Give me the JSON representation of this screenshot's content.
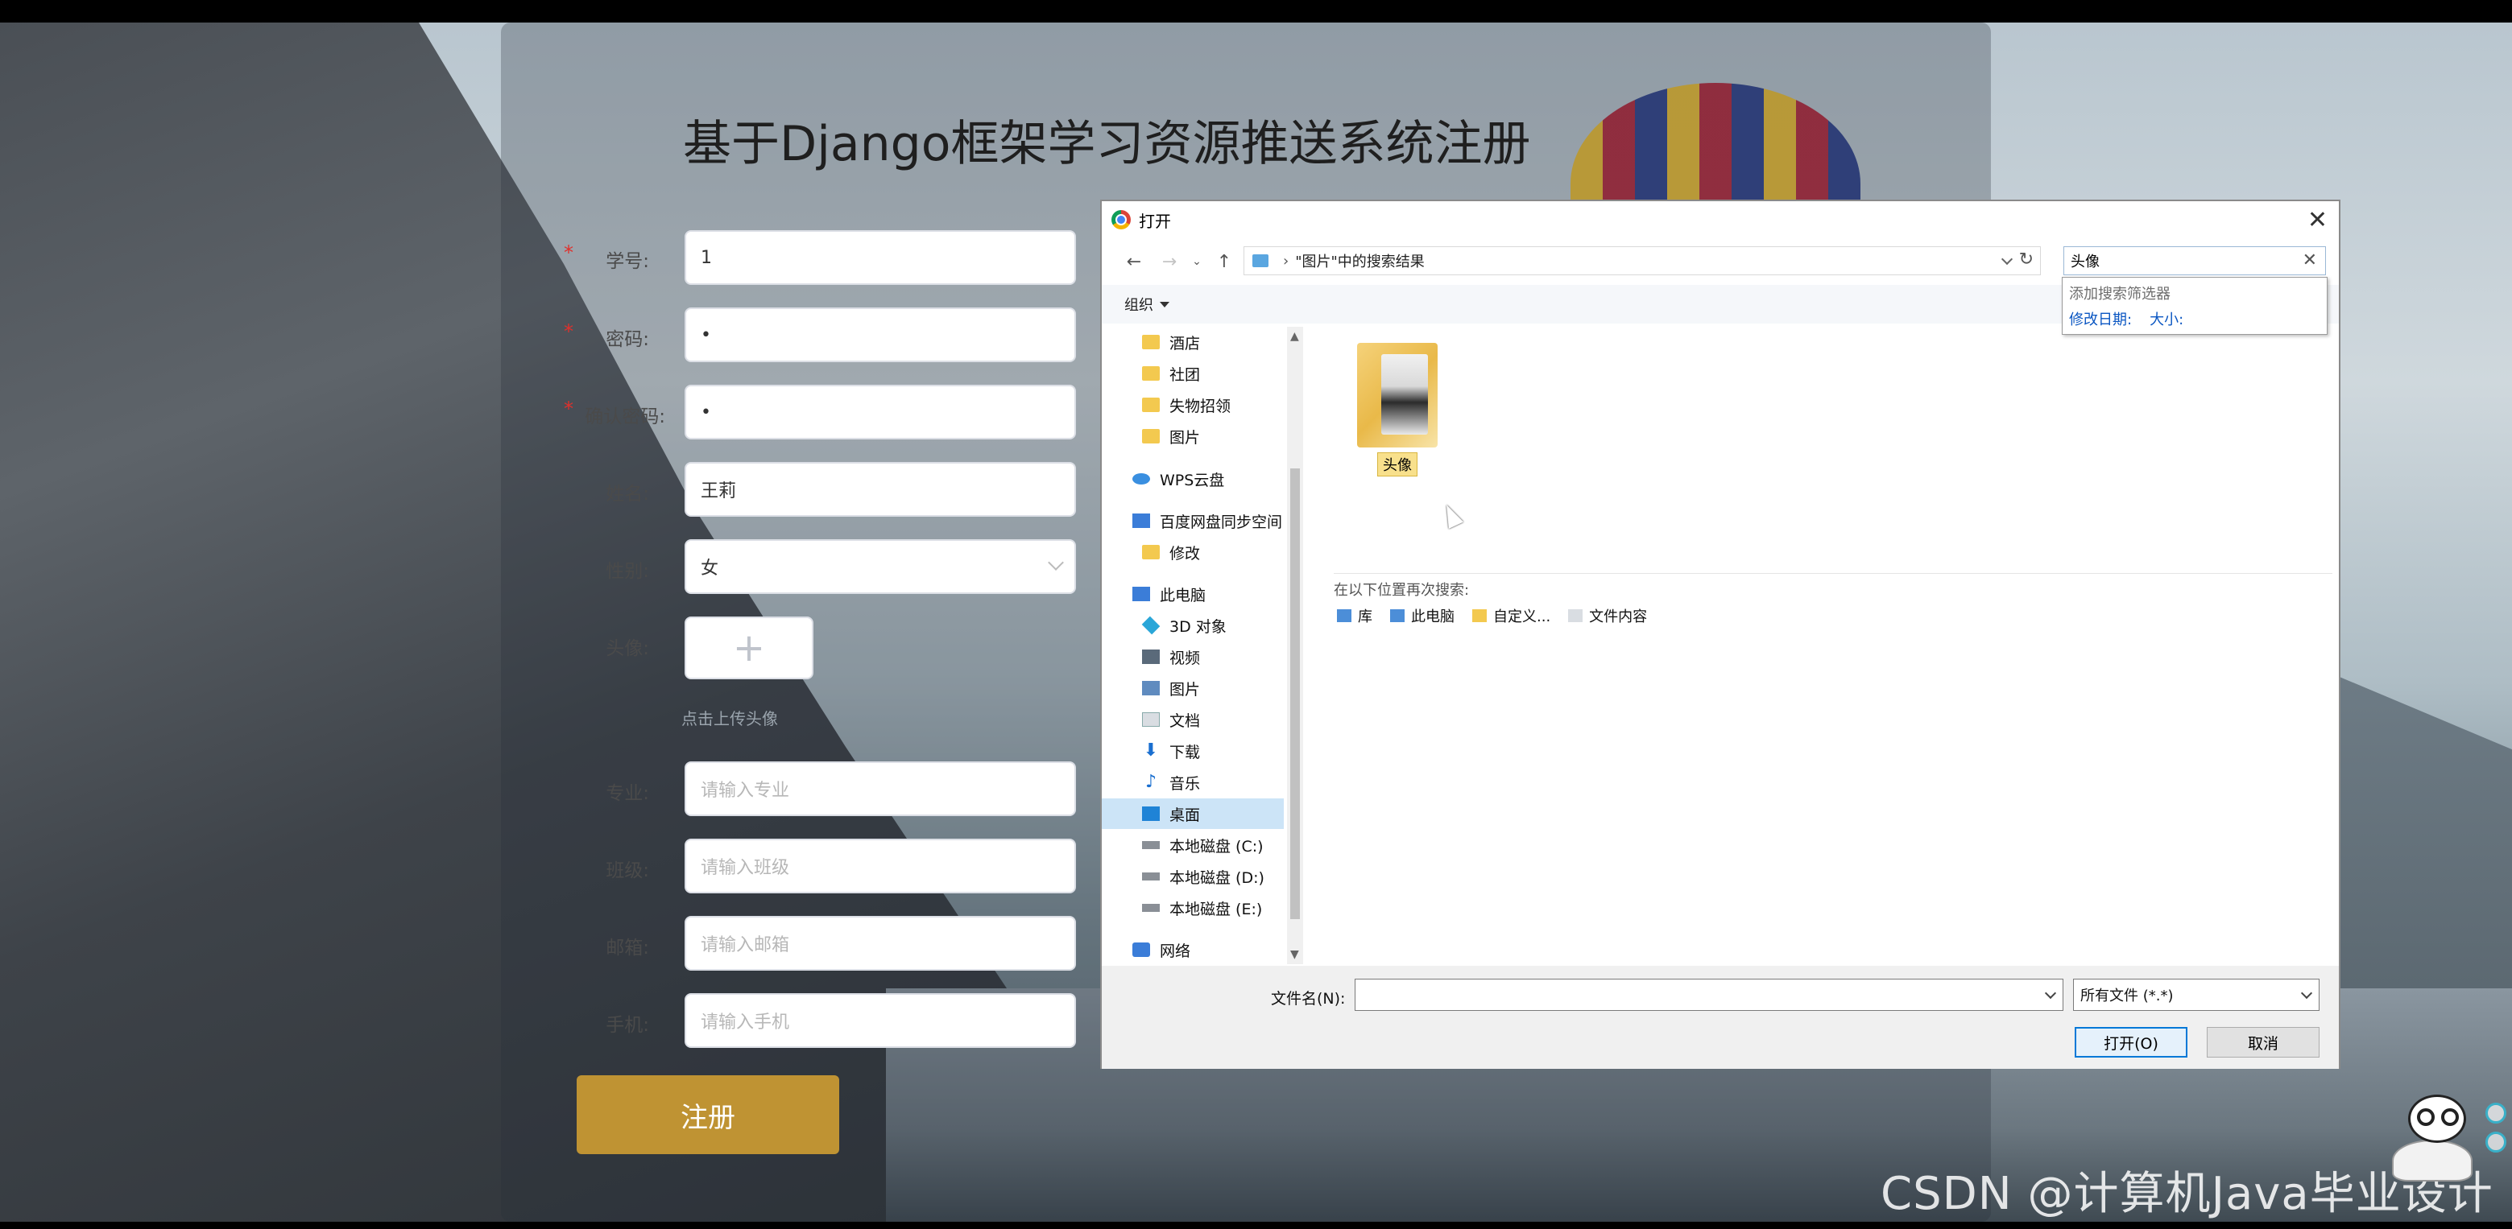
{
  "register": {
    "title": "基于Django框架学习资源推送系统注册",
    "fields": [
      {
        "label": "学号:",
        "value": "1",
        "placeholder": "",
        "required": true
      },
      {
        "label": "密码:",
        "value": "•",
        "placeholder": "",
        "required": true
      },
      {
        "label": "确认密码:",
        "value": "•",
        "placeholder": "",
        "required": true
      },
      {
        "label": "姓名:",
        "value": "王莉",
        "placeholder": "",
        "required": false
      },
      {
        "label": "性别:",
        "value": "女",
        "placeholder": "",
        "required": false
      },
      {
        "label": "头像:",
        "value": "",
        "placeholder": "",
        "required": false
      },
      {
        "label": "专业:",
        "value": "",
        "placeholder": "请输入专业",
        "required": false
      },
      {
        "label": "班级:",
        "value": "",
        "placeholder": "请输入班级",
        "required": false
      },
      {
        "label": "邮箱:",
        "value": "",
        "placeholder": "请输入邮箱",
        "required": false
      },
      {
        "label": "手机:",
        "value": "",
        "placeholder": "请输入手机",
        "required": false
      }
    ],
    "upload_plus": "+",
    "upload_hint": "点击上传头像",
    "submit_label": "注册"
  },
  "dialog": {
    "title": "打开",
    "close_glyph": "✕",
    "address": "\"图片\"中的搜索结果",
    "address_sep": "›",
    "search_value": "头像",
    "search_clear": "✕",
    "suggest": {
      "header": "添加搜索筛选器",
      "filters": [
        "修改日期:",
        "大小:"
      ]
    },
    "organize_label": "组织",
    "tree": [
      {
        "label": "酒店",
        "icon": "folder-icon",
        "indent": 1
      },
      {
        "label": "社团",
        "icon": "folder-icon",
        "indent": 1
      },
      {
        "label": "失物招领",
        "icon": "folder-icon",
        "indent": 1
      },
      {
        "label": "图片",
        "icon": "folder-icon",
        "indent": 1
      },
      {
        "label": "WPS云盘",
        "icon": "cloud-icon",
        "indent": 0
      },
      {
        "label": "百度网盘同步空间",
        "icon": "baidu-icon",
        "indent": 0
      },
      {
        "label": "修改",
        "icon": "folder-icon",
        "indent": 1
      },
      {
        "label": "此电脑",
        "icon": "computer-icon",
        "indent": 0
      },
      {
        "label": "3D 对象",
        "icon": "cube-icon",
        "indent": 1
      },
      {
        "label": "视频",
        "icon": "video-icon",
        "indent": 1
      },
      {
        "label": "图片",
        "icon": "pictures-icon",
        "indent": 1
      },
      {
        "label": "文档",
        "icon": "document-icon",
        "indent": 1
      },
      {
        "label": "下载",
        "icon": "download-icon",
        "indent": 1
      },
      {
        "label": "音乐",
        "icon": "music-icon",
        "indent": 1
      },
      {
        "label": "桌面",
        "icon": "desktop-icon",
        "indent": 1,
        "selected": true
      },
      {
        "label": "本地磁盘 (C:)",
        "icon": "disk-icon",
        "indent": 1
      },
      {
        "label": "本地磁盘 (D:)",
        "icon": "disk-icon",
        "indent": 1
      },
      {
        "label": "本地磁盘 (E:)",
        "icon": "disk-icon",
        "indent": 1
      },
      {
        "label": "网络",
        "icon": "network-icon",
        "indent": 0
      }
    ],
    "result_label": "头像",
    "search_again_title": "在以下位置再次搜索:",
    "search_again_links": [
      "库",
      "此电脑",
      "自定义...",
      "文件内容"
    ],
    "filename_label": "文件名(N):",
    "filename_value": "",
    "filetype_value": "所有文件 (*.*)",
    "open_label": "打开(O)",
    "cancel_label": "取消"
  },
  "watermark": "CSDN @计算机Java毕业设计"
}
